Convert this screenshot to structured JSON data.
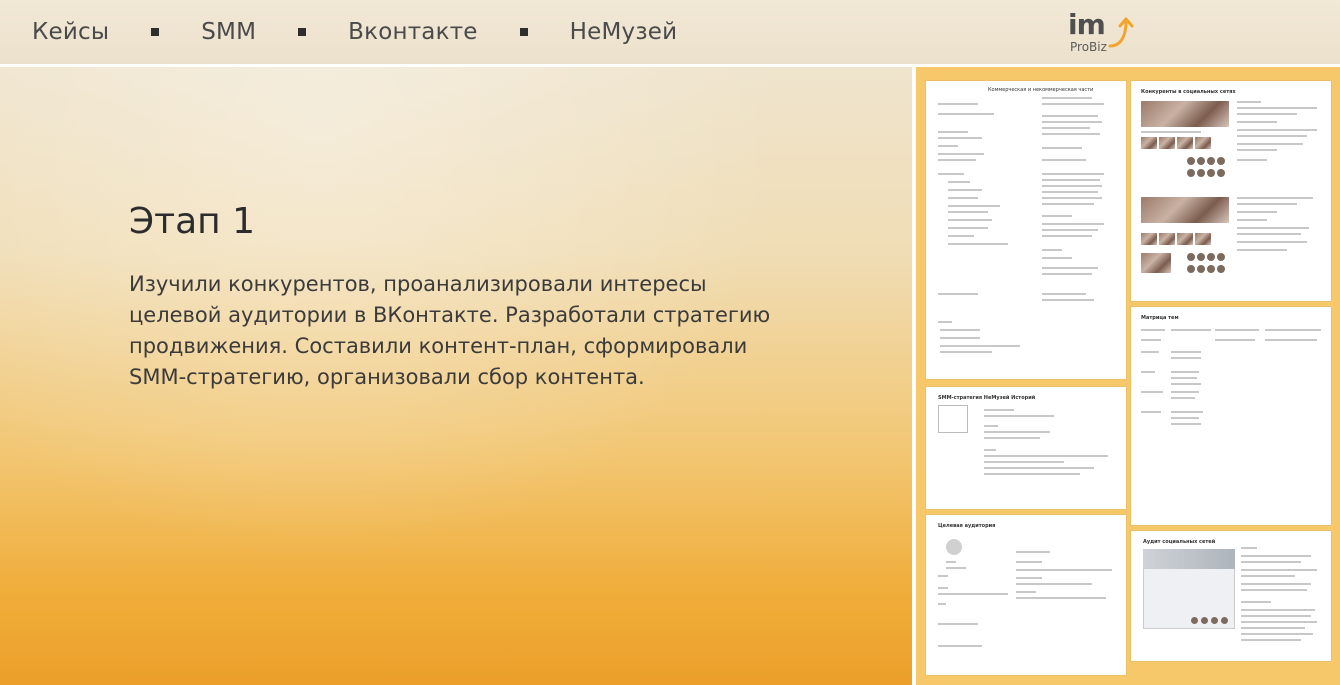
{
  "nav": {
    "breadcrumbs": [
      {
        "label": "Кейсы"
      },
      {
        "label": "SMM"
      },
      {
        "label": "Вконтакте"
      },
      {
        "label": "НеМузей"
      }
    ],
    "logo": {
      "mark": "im",
      "sub": "ProBiz"
    }
  },
  "content": {
    "title": "Этап 1",
    "description": "Изучили конкурентов, проанализировали интересы целевой аудитории в ВКонтакте. Разработали стратегию продвижения. Составили контент-план, сформировали SMM-стратегию, организовали сбор контента."
  },
  "gallery": {
    "docs": [
      {
        "heading": "Коммерческая и некоммерческая части"
      },
      {
        "heading": "Конкуренты в социальных сетях"
      },
      {
        "heading": "SMM-стратегия НеМузей Историй"
      },
      {
        "heading": "Матрица тем"
      },
      {
        "heading": "Целевая аудитория"
      },
      {
        "heading": "Аудит социальных сетей"
      }
    ]
  },
  "colors": {
    "accent_orange": "#f0ad3a",
    "text_dark": "#2c2c2c",
    "nav_bg": "#efe6d3"
  }
}
